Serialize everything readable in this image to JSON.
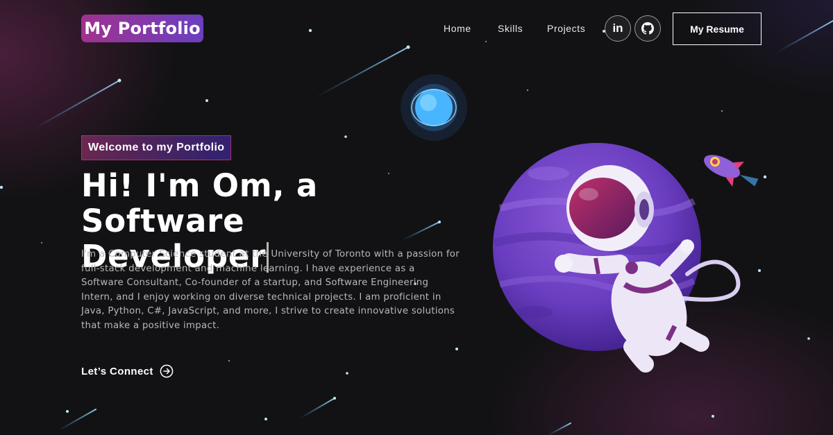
{
  "nav": {
    "logo": "My Portfolio",
    "links": [
      "Home",
      "Skills",
      "Projects"
    ],
    "social": [
      {
        "name": "linkedin",
        "glyph": "in"
      },
      {
        "name": "github",
        "glyph": "github-icon"
      }
    ],
    "resume_label": "My Resume"
  },
  "hero": {
    "tagline": "Welcome to my Portfolio",
    "headline_line1": "Hi! I'm Om, a Software",
    "headline_line2": "Developer",
    "description": "I'm a Computer Science student at the University of Toronto with a passion for full-stack development and machine learning. I have experience as a Software Consultant, Co-founder of a startup, and Software Engineering Intern, and I enjoy working on diverse technical projects. I am proficient in Java, Python, C#, JavaScript, and more, I strive to create innovative solutions that make a positive impact.",
    "cta_label": "Let’s Connect"
  },
  "colors": {
    "accent_magenta": "#a0328f",
    "accent_violet": "#6b3fc0",
    "background": "#121214",
    "body_text": "#b8b8b8"
  }
}
